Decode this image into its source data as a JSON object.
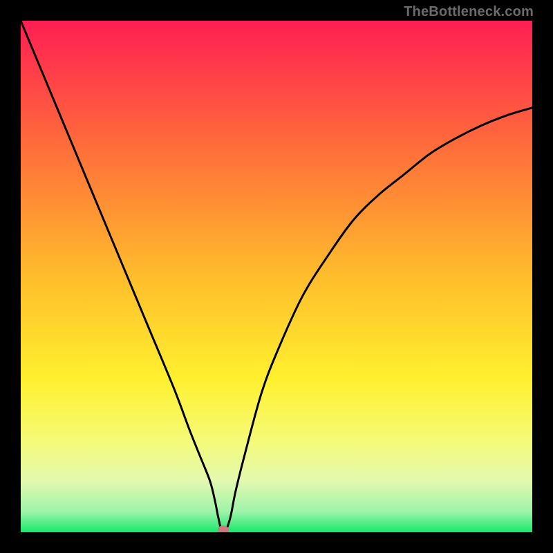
{
  "watermark": "TheBottleneck.com",
  "chart_data": {
    "type": "line",
    "title": "",
    "xlabel": "",
    "ylabel": "",
    "xlim": [
      0,
      100
    ],
    "ylim": [
      0,
      100
    ],
    "x": [
      0,
      5,
      10,
      15,
      20,
      25,
      30,
      33,
      35,
      37,
      38,
      38.6,
      39.3,
      40,
      41,
      42,
      44,
      47,
      50,
      55,
      60,
      65,
      70,
      75,
      80,
      85,
      90,
      95,
      100
    ],
    "values": [
      100,
      88,
      76,
      64,
      52,
      40,
      28,
      20,
      15,
      10,
      6,
      3,
      0.2,
      0.2,
      3,
      8,
      16,
      27,
      35,
      46,
      54,
      61,
      66,
      70,
      74,
      77,
      79.5,
      81.5,
      83
    ],
    "minimum_marker": {
      "x": 39.6,
      "y": 0.5
    },
    "gradient_stops": [
      {
        "offset": 0.0,
        "color": "#ff1e53"
      },
      {
        "offset": 0.25,
        "color": "#ff6e3a"
      },
      {
        "offset": 0.5,
        "color": "#ffbd2c"
      },
      {
        "offset": 0.7,
        "color": "#fff02e"
      },
      {
        "offset": 0.82,
        "color": "#f5fa77"
      },
      {
        "offset": 0.9,
        "color": "#e3f9b0"
      },
      {
        "offset": 0.96,
        "color": "#9df3a9"
      },
      {
        "offset": 1.0,
        "color": "#17e86a"
      }
    ],
    "curve_color": "#000000",
    "marker_color": "#cc7a7d"
  }
}
